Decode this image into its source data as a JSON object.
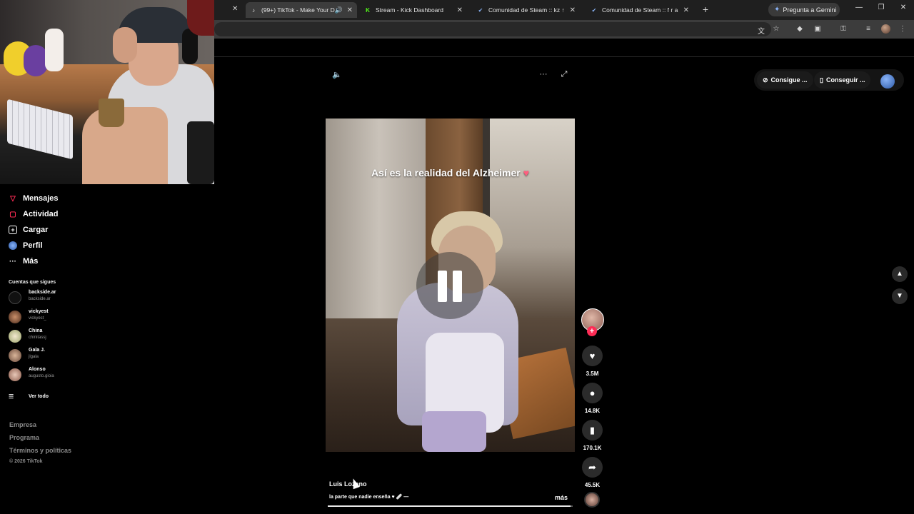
{
  "browser": {
    "tabs": [
      {
        "title": "(99+) TikTok - Make Your D",
        "favicon": "tiktok-icon",
        "active": true
      },
      {
        "title": "Stream - Kick Dashboard",
        "favicon": "kick-icon",
        "active": false
      },
      {
        "title": "Comunidad de Steam :: kz ↑",
        "favicon": "steam-check-icon",
        "active": false
      },
      {
        "title": "Comunidad de Steam :: f r a",
        "favicon": "steam-check-icon",
        "active": false
      }
    ],
    "gemini_label": "Pregunta a Gemini",
    "new_tab": "+",
    "colors": {
      "tabbar": "#1f1f1f",
      "toolbar": "#3c3c3c"
    }
  },
  "sidebar": {
    "items": [
      {
        "label": "Mensajes",
        "icon": "message-icon"
      },
      {
        "label": "Actividad",
        "icon": "activity-icon"
      },
      {
        "label": "Cargar",
        "icon": "upload-icon"
      },
      {
        "label": "Perfil",
        "icon": "profile-icon"
      },
      {
        "label": "Más",
        "icon": "more-dots-icon"
      }
    ],
    "following_title": "Cuentas que sigues",
    "accounts": [
      {
        "name": "backside.ar",
        "handle": "backside.ar"
      },
      {
        "name": "vickyest",
        "handle": "vickyest_"
      },
      {
        "name": "China",
        "handle": "chinitassj"
      },
      {
        "name": "Gala J.",
        "handle": "jlgala"
      },
      {
        "name": "Alonso",
        "handle": "augusto.gioia"
      }
    ],
    "see_all": "Ver todo",
    "footer_links": [
      "Empresa",
      "Programa",
      "Términos y políticas"
    ],
    "copyright": "© 2026 TikTok"
  },
  "top_controls": {
    "coins_label": "Consigue ...",
    "app_label": "Conseguir ..."
  },
  "video": {
    "caption": "Así es la realidad del Alzheimer",
    "caption_emoji": "♥",
    "author": "Luis Lozano",
    "description": "la parte que nadie enseña ♥ 🩹 —",
    "more_label": "más",
    "progress": 0.99,
    "likes": "3.5M",
    "comments": "14.8K",
    "saves": "170.1K",
    "shares": "45.5K",
    "accent": "#fe2c55"
  }
}
